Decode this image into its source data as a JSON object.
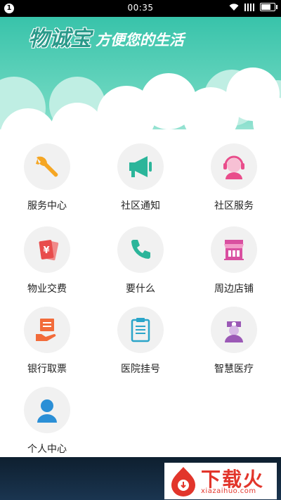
{
  "status_bar": {
    "time": "00:35",
    "notification": "1"
  },
  "header": {
    "logo_text": "物诚宝",
    "slogan": "方便您的生活"
  },
  "menu": [
    {
      "label": "服务中心",
      "icon": "wrench-icon"
    },
    {
      "label": "社区通知",
      "icon": "megaphone-icon"
    },
    {
      "label": "社区服务",
      "icon": "support-agent-icon"
    },
    {
      "label": "物业交费",
      "icon": "yuan-cards-icon"
    },
    {
      "label": "要什么",
      "icon": "phone-icon"
    },
    {
      "label": "周边店铺",
      "icon": "shop-icon"
    },
    {
      "label": "银行取票",
      "icon": "ticket-hand-icon"
    },
    {
      "label": "医院挂号",
      "icon": "clipboard-icon"
    },
    {
      "label": "智慧医疗",
      "icon": "nurse-icon"
    },
    {
      "label": "个人中心",
      "icon": "user-icon"
    }
  ],
  "watermark": {
    "name": "下载火",
    "url": "xiazaihuo.com"
  },
  "colors": {
    "accent": "#38c3aa",
    "bottom_bar": "#0e1f2f",
    "watermark_red": "#e2352b"
  }
}
